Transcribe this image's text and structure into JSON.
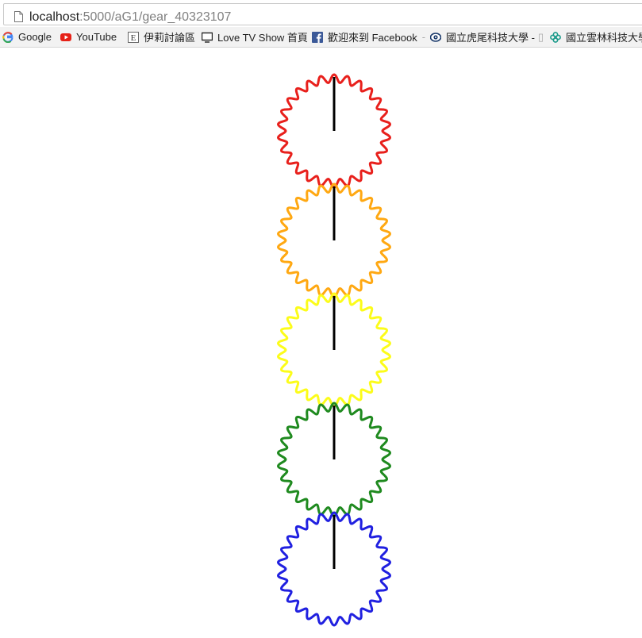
{
  "browser": {
    "url_host": "localhost",
    "url_path": ":5000/aG1/gear_40323107"
  },
  "bookmarks": [
    {
      "label": "Google",
      "icon": "google-icon"
    },
    {
      "label": "YouTube",
      "icon": "youtube-icon"
    },
    {
      "label": "伊莉討論區",
      "icon": "eyny-icon"
    },
    {
      "label": "Love TV Show 首頁",
      "icon": "tv-icon"
    },
    {
      "label": "歡迎來到 Facebook",
      "icon": "facebook-icon",
      "suffix": "-"
    },
    {
      "label": "國立虎尾科技大學 -",
      "icon": "nfu-icon"
    },
    {
      "label": "國立雲林科技大學",
      "icon": "yuntech-icon"
    }
  ],
  "gears": [
    {
      "color": "#e8201c",
      "teeth": 26
    },
    {
      "color": "#ffa812",
      "teeth": 26
    },
    {
      "color": "#fcfc1a",
      "teeth": 26
    },
    {
      "color": "#1f8a1f",
      "teeth": 26
    },
    {
      "color": "#2020e0",
      "teeth": 26
    }
  ],
  "indicator_color": "#000000"
}
